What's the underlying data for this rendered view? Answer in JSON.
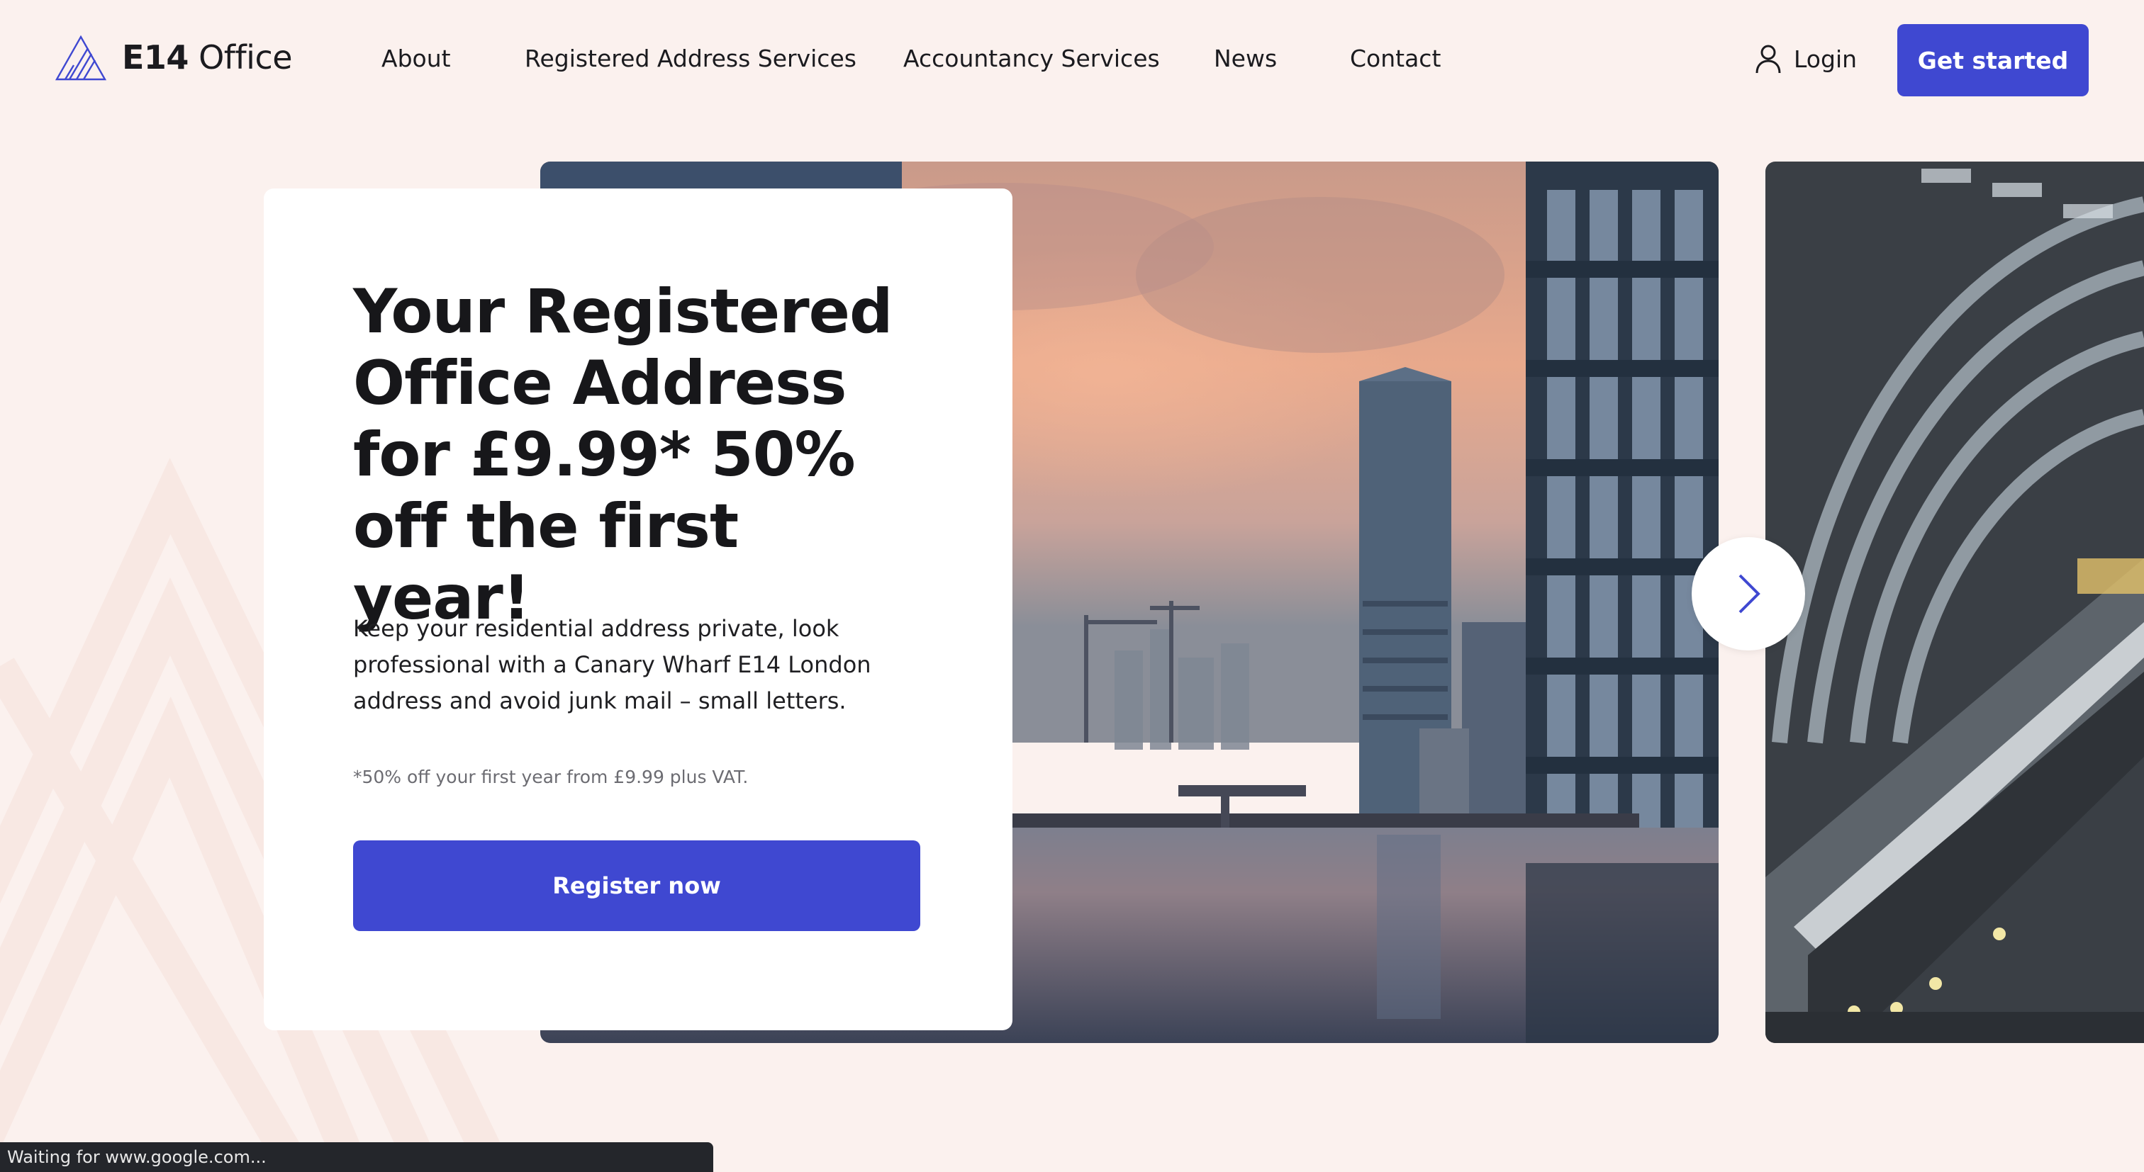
{
  "header": {
    "logo": {
      "text_bold": "E14",
      "text_regular": "Office"
    },
    "nav": [
      {
        "label": "About"
      },
      {
        "label": "Registered Address Services"
      },
      {
        "label": "Accountancy Services"
      },
      {
        "label": "News"
      },
      {
        "label": "Contact"
      }
    ],
    "login_label": "Login",
    "cta_label": "Get started"
  },
  "hero": {
    "title": "Your Registered Office Address for £9.99* 50% off the first year!",
    "body": "Keep your residential address private, look professional with a Canary Wharf E14 London address and avoid junk mail – small letters.",
    "note": "*50% off your first year from £9.99 plus VAT.",
    "cta_label": "Register now"
  },
  "carousel": {
    "next_icon": "chevron-right-icon"
  },
  "status_bar": {
    "text": "Waiting for www.google.com..."
  },
  "colors": {
    "background": "#fbf1ee",
    "accent": "#3f48d1",
    "text": "#1b1b1f"
  }
}
